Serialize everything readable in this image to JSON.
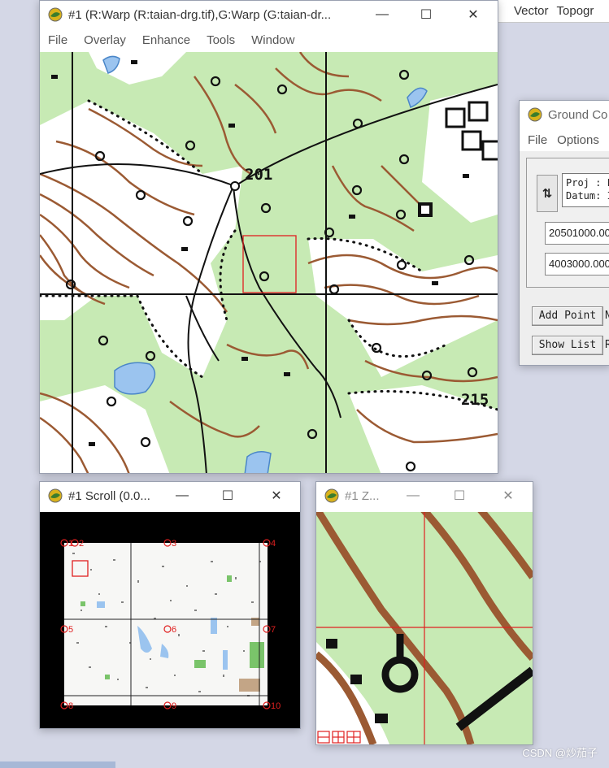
{
  "app_menu_top": {
    "vector": "Vector",
    "topographic": "Topogr"
  },
  "main_window": {
    "title": "#1 (R:Warp (R:taian-drg.tif),G:Warp (G:taian-dr...",
    "menu": [
      "File",
      "Overlay",
      "Enhance",
      "Tools",
      "Window"
    ],
    "map_labels": {
      "elev_201": "201",
      "elev_215": "215"
    }
  },
  "gcp_window": {
    "title": "Ground Co",
    "menu": [
      "File",
      "Options"
    ],
    "proj_text": "Proj : F\nDatum: I",
    "easting": "20501000.00",
    "northing": "4003000.000",
    "add_point": "Add Point",
    "add_point_side": "N",
    "show_list": "Show List",
    "show_list_side": "R"
  },
  "scroll_window": {
    "title": "#1 Scroll (0.0...",
    "gcp_markers": [
      "1",
      "2",
      "3",
      "4",
      "5",
      "6",
      "7",
      "8",
      "9",
      "10"
    ]
  },
  "zoom_window": {
    "title": "#1 Z..."
  },
  "window_controls": {
    "minimize": "—",
    "maximize": "☐",
    "close": "✕"
  },
  "watermark": "CSDN @炒茄子",
  "colors": {
    "map_green": "#c7eab4",
    "contour_brown": "#9b5a33",
    "water_blue": "#9bc4ef",
    "marker_red": "#e02020"
  }
}
